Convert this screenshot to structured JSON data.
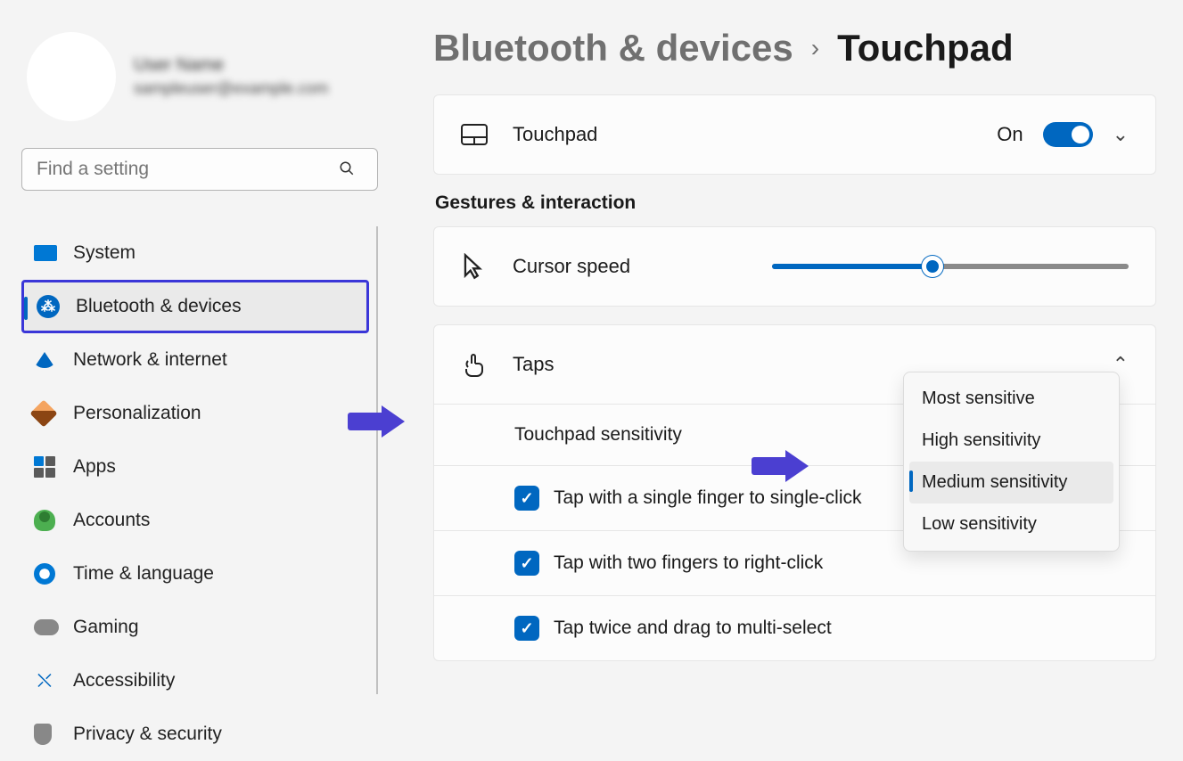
{
  "profile": {
    "name": "User Name",
    "email": "sampleuser@example.com"
  },
  "search": {
    "placeholder": "Find a setting"
  },
  "nav": [
    {
      "id": "system",
      "label": "System"
    },
    {
      "id": "bluetooth",
      "label": "Bluetooth & devices",
      "active": true
    },
    {
      "id": "network",
      "label": "Network & internet"
    },
    {
      "id": "personalization",
      "label": "Personalization"
    },
    {
      "id": "apps",
      "label": "Apps"
    },
    {
      "id": "accounts",
      "label": "Accounts"
    },
    {
      "id": "time",
      "label": "Time & language"
    },
    {
      "id": "gaming",
      "label": "Gaming"
    },
    {
      "id": "accessibility",
      "label": "Accessibility"
    },
    {
      "id": "privacy",
      "label": "Privacy & security"
    }
  ],
  "breadcrumb": {
    "parent": "Bluetooth & devices",
    "current": "Touchpad"
  },
  "touchpad_toggle": {
    "label": "Touchpad",
    "state_text": "On"
  },
  "section_title": "Gestures & interaction",
  "cursor_speed": {
    "label": "Cursor speed",
    "value": 45
  },
  "taps": {
    "label": "Taps",
    "sensitivity_label": "Touchpad sensitivity",
    "options": [
      "Most sensitive",
      "High sensitivity",
      "Medium sensitivity",
      "Low sensitivity"
    ],
    "selected_index": 2,
    "checkboxes": [
      "Tap with a single finger to single-click",
      "Tap with two fingers to right-click",
      "Tap twice and drag to multi-select"
    ]
  }
}
